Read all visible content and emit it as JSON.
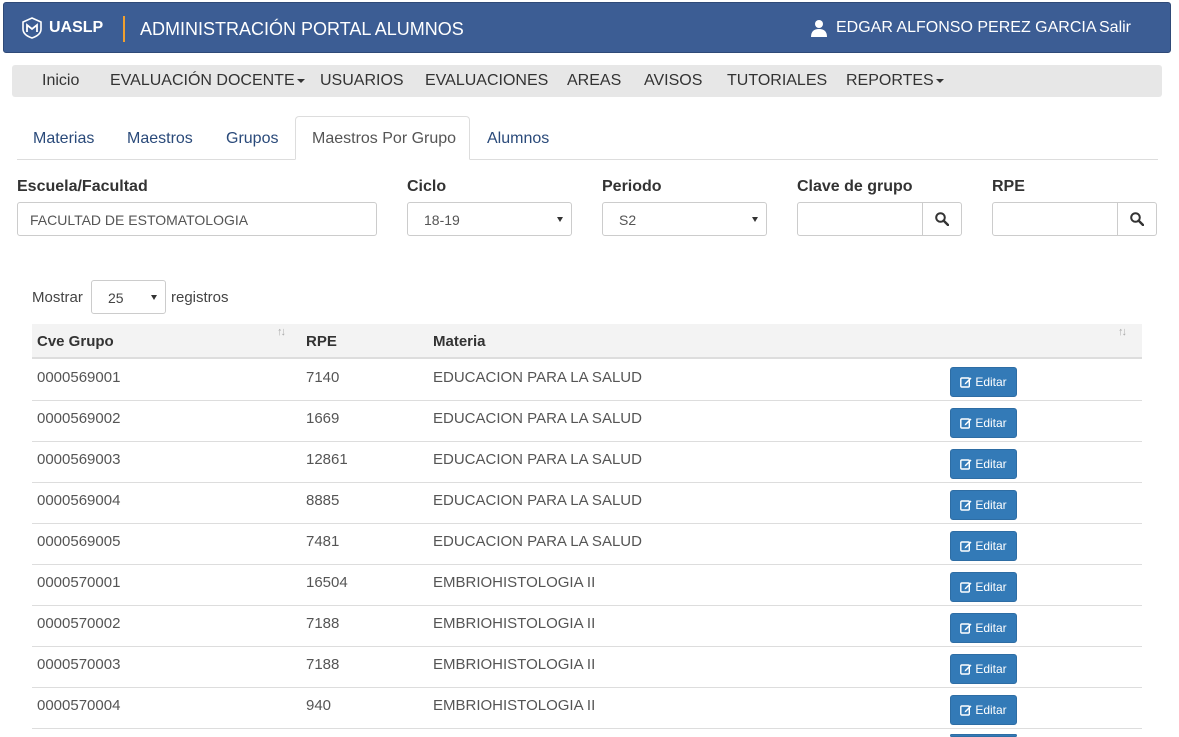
{
  "header": {
    "logo_text": "UASLP",
    "title": "ADMINISTRACIÓN PORTAL ALUMNOS",
    "user_name": "EDGAR ALFONSO PEREZ GARCIA",
    "logout_label": "Salir",
    "bg_color": "#3c5d94"
  },
  "menu": {
    "items": [
      {
        "label": "Inicio",
        "dropdown": false
      },
      {
        "label": "EVALUACIÓN DOCENTE",
        "dropdown": true
      },
      {
        "label": "USUARIOS",
        "dropdown": false
      },
      {
        "label": "EVALUACIONES",
        "dropdown": false
      },
      {
        "label": "AREAS",
        "dropdown": false
      },
      {
        "label": "AVISOS",
        "dropdown": false
      },
      {
        "label": "TUTORIALES",
        "dropdown": false
      },
      {
        "label": "REPORTES",
        "dropdown": true
      }
    ]
  },
  "tabs": [
    {
      "label": "Materias"
    },
    {
      "label": "Maestros"
    },
    {
      "label": "Grupos"
    },
    {
      "label": "Maestros Por Grupo",
      "active": true
    },
    {
      "label": "Alumnos"
    }
  ],
  "filters": {
    "school_label": "Escuela/Facultad",
    "school_value": "FACULTAD DE ESTOMATOLOGIA",
    "cycle_label": "Ciclo",
    "cycle_value": "18-19",
    "period_label": "Periodo",
    "period_value": "S2",
    "group_key_label": "Clave de grupo",
    "group_key_value": "",
    "rpe_label": "RPE",
    "rpe_value": ""
  },
  "length_menu": {
    "prefix": "Mostrar",
    "value": "25",
    "suffix": "registros"
  },
  "table": {
    "columns": [
      "Cve Grupo",
      "RPE",
      "Materia"
    ],
    "edit_label": "Editar",
    "button_color": "#337ab7",
    "rows": [
      {
        "group": "0000569001",
        "rpe": "7140",
        "subject": "EDUCACION PARA LA SALUD"
      },
      {
        "group": "0000569002",
        "rpe": "1669",
        "subject": "EDUCACION PARA LA SALUD"
      },
      {
        "group": "0000569003",
        "rpe": "12861",
        "subject": "EDUCACION PARA LA SALUD"
      },
      {
        "group": "0000569004",
        "rpe": "8885",
        "subject": "EDUCACION PARA LA SALUD"
      },
      {
        "group": "0000569005",
        "rpe": "7481",
        "subject": "EDUCACION PARA LA SALUD"
      },
      {
        "group": "0000570001",
        "rpe": "16504",
        "subject": "EMBRIOHISTOLOGIA II"
      },
      {
        "group": "0000570002",
        "rpe": "7188",
        "subject": "EMBRIOHISTOLOGIA II"
      },
      {
        "group": "0000570003",
        "rpe": "7188",
        "subject": "EMBRIOHISTOLOGIA II"
      },
      {
        "group": "0000570004",
        "rpe": "940",
        "subject": "EMBRIOHISTOLOGIA II"
      }
    ]
  }
}
